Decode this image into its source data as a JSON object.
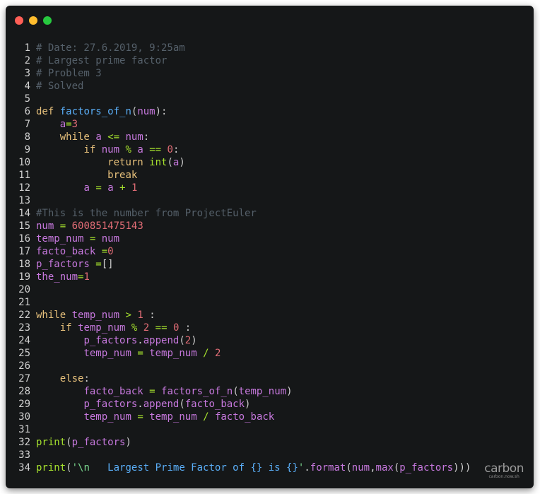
{
  "window_controls": {
    "close_color": "#ff5f56",
    "minimize_color": "#ffbd2e",
    "maximize_color": "#27c93f"
  },
  "theme": {
    "background": "#151718",
    "default_text": "#d0d0d0",
    "comment": "#55606a",
    "keyword": "#e6c07b",
    "function": "#5aaef7",
    "variable": "#c678dd",
    "number": "#e06c75",
    "string": "#7bd88f",
    "builtin": "#a6e22e"
  },
  "code_lines": [
    [
      {
        "t": "# Date: 27.6.2019, 9:25am",
        "c": "comment"
      }
    ],
    [
      {
        "t": "# Largest prime factor",
        "c": "comment"
      }
    ],
    [
      {
        "t": "# Problem 3",
        "c": "comment"
      }
    ],
    [
      {
        "t": "# Solved",
        "c": "comment"
      }
    ],
    [],
    [
      {
        "t": "def",
        "c": "keyword"
      },
      {
        "t": " "
      },
      {
        "t": "factors_of_n",
        "c": "function"
      },
      {
        "t": "("
      },
      {
        "t": "num",
        "c": "variable"
      },
      {
        "t": "):"
      }
    ],
    [
      {
        "t": "    "
      },
      {
        "t": "a",
        "c": "variable"
      },
      {
        "t": "=",
        "c": "builtin"
      },
      {
        "t": "3",
        "c": "number"
      }
    ],
    [
      {
        "t": "    "
      },
      {
        "t": "while",
        "c": "keyword"
      },
      {
        "t": " "
      },
      {
        "t": "a",
        "c": "variable"
      },
      {
        "t": " "
      },
      {
        "t": "<=",
        "c": "builtin"
      },
      {
        "t": " "
      },
      {
        "t": "num",
        "c": "variable"
      },
      {
        "t": ":"
      }
    ],
    [
      {
        "t": "        "
      },
      {
        "t": "if",
        "c": "keyword"
      },
      {
        "t": " "
      },
      {
        "t": "num",
        "c": "variable"
      },
      {
        "t": " "
      },
      {
        "t": "%",
        "c": "builtin"
      },
      {
        "t": " "
      },
      {
        "t": "a",
        "c": "variable"
      },
      {
        "t": " "
      },
      {
        "t": "==",
        "c": "builtin"
      },
      {
        "t": " "
      },
      {
        "t": "0",
        "c": "number"
      },
      {
        "t": ":"
      }
    ],
    [
      {
        "t": "            "
      },
      {
        "t": "return",
        "c": "keyword"
      },
      {
        "t": " "
      },
      {
        "t": "int",
        "c": "builtin"
      },
      {
        "t": "("
      },
      {
        "t": "a",
        "c": "variable"
      },
      {
        "t": ")"
      }
    ],
    [
      {
        "t": "            "
      },
      {
        "t": "break",
        "c": "keyword"
      }
    ],
    [
      {
        "t": "        "
      },
      {
        "t": "a",
        "c": "variable"
      },
      {
        "t": " "
      },
      {
        "t": "=",
        "c": "builtin"
      },
      {
        "t": " "
      },
      {
        "t": "a",
        "c": "variable"
      },
      {
        "t": " "
      },
      {
        "t": "+",
        "c": "builtin"
      },
      {
        "t": " "
      },
      {
        "t": "1",
        "c": "number"
      }
    ],
    [],
    [
      {
        "t": "#This is the number from ProjectEuler",
        "c": "comment"
      }
    ],
    [
      {
        "t": "num",
        "c": "variable"
      },
      {
        "t": " "
      },
      {
        "t": "=",
        "c": "builtin"
      },
      {
        "t": " "
      },
      {
        "t": "600851475143",
        "c": "number"
      }
    ],
    [
      {
        "t": "temp_num",
        "c": "variable"
      },
      {
        "t": " "
      },
      {
        "t": "=",
        "c": "builtin"
      },
      {
        "t": " "
      },
      {
        "t": "num",
        "c": "variable"
      }
    ],
    [
      {
        "t": "facto_back",
        "c": "variable"
      },
      {
        "t": " "
      },
      {
        "t": "=",
        "c": "builtin"
      },
      {
        "t": "0",
        "c": "number"
      }
    ],
    [
      {
        "t": "p_factors",
        "c": "variable"
      },
      {
        "t": " "
      },
      {
        "t": "=",
        "c": "builtin"
      },
      {
        "t": "[]"
      }
    ],
    [
      {
        "t": "the_num",
        "c": "variable"
      },
      {
        "t": "=",
        "c": "builtin"
      },
      {
        "t": "1",
        "c": "number"
      }
    ],
    [],
    [],
    [
      {
        "t": "while",
        "c": "keyword"
      },
      {
        "t": " "
      },
      {
        "t": "temp_num",
        "c": "variable"
      },
      {
        "t": " "
      },
      {
        "t": ">",
        "c": "builtin"
      },
      {
        "t": " "
      },
      {
        "t": "1",
        "c": "number"
      },
      {
        "t": " :"
      }
    ],
    [
      {
        "t": "    "
      },
      {
        "t": "if",
        "c": "keyword"
      },
      {
        "t": " "
      },
      {
        "t": "temp_num",
        "c": "variable"
      },
      {
        "t": " "
      },
      {
        "t": "%",
        "c": "builtin"
      },
      {
        "t": " "
      },
      {
        "t": "2",
        "c": "number"
      },
      {
        "t": " "
      },
      {
        "t": "==",
        "c": "builtin"
      },
      {
        "t": " "
      },
      {
        "t": "0",
        "c": "number"
      },
      {
        "t": " :"
      }
    ],
    [
      {
        "t": "        "
      },
      {
        "t": "p_factors",
        "c": "variable"
      },
      {
        "t": "."
      },
      {
        "t": "append",
        "c": "variable"
      },
      {
        "t": "("
      },
      {
        "t": "2",
        "c": "number"
      },
      {
        "t": ")"
      }
    ],
    [
      {
        "t": "        "
      },
      {
        "t": "temp_num",
        "c": "variable"
      },
      {
        "t": " "
      },
      {
        "t": "=",
        "c": "builtin"
      },
      {
        "t": " "
      },
      {
        "t": "temp_num",
        "c": "variable"
      },
      {
        "t": " "
      },
      {
        "t": "/",
        "c": "builtin"
      },
      {
        "t": " "
      },
      {
        "t": "2",
        "c": "number"
      }
    ],
    [],
    [
      {
        "t": "    "
      },
      {
        "t": "else",
        "c": "keyword"
      },
      {
        "t": ":"
      }
    ],
    [
      {
        "t": "        "
      },
      {
        "t": "facto_back",
        "c": "variable"
      },
      {
        "t": " "
      },
      {
        "t": "=",
        "c": "builtin"
      },
      {
        "t": " "
      },
      {
        "t": "factors_of_n",
        "c": "variable"
      },
      {
        "t": "("
      },
      {
        "t": "temp_num",
        "c": "variable"
      },
      {
        "t": ")"
      }
    ],
    [
      {
        "t": "        "
      },
      {
        "t": "p_factors",
        "c": "variable"
      },
      {
        "t": "."
      },
      {
        "t": "append",
        "c": "variable"
      },
      {
        "t": "("
      },
      {
        "t": "facto_back",
        "c": "variable"
      },
      {
        "t": ")"
      }
    ],
    [
      {
        "t": "        "
      },
      {
        "t": "temp_num",
        "c": "variable"
      },
      {
        "t": " "
      },
      {
        "t": "=",
        "c": "builtin"
      },
      {
        "t": " "
      },
      {
        "t": "temp_num",
        "c": "variable"
      },
      {
        "t": " "
      },
      {
        "t": "/",
        "c": "builtin"
      },
      {
        "t": " "
      },
      {
        "t": "facto_back",
        "c": "variable"
      }
    ],
    [],
    [
      {
        "t": "print",
        "c": "builtin"
      },
      {
        "t": "("
      },
      {
        "t": "p_factors",
        "c": "variable"
      },
      {
        "t": ")"
      }
    ],
    [],
    [
      {
        "t": "print",
        "c": "builtin"
      },
      {
        "t": "("
      },
      {
        "t": "'\\n   ",
        "c": "string"
      },
      {
        "t": "Largest Prime Factor of {} is {}",
        "c": "function"
      },
      {
        "t": "'",
        "c": "string"
      },
      {
        "t": "."
      },
      {
        "t": "format",
        "c": "variable"
      },
      {
        "t": "("
      },
      {
        "t": "num",
        "c": "variable"
      },
      {
        "t": ","
      },
      {
        "t": "max",
        "c": "variable"
      },
      {
        "t": "("
      },
      {
        "t": "p_factors",
        "c": "variable"
      },
      {
        "t": ")))"
      }
    ]
  ],
  "watermark": {
    "logo": "carbon",
    "url": "carbon.now.sh"
  }
}
